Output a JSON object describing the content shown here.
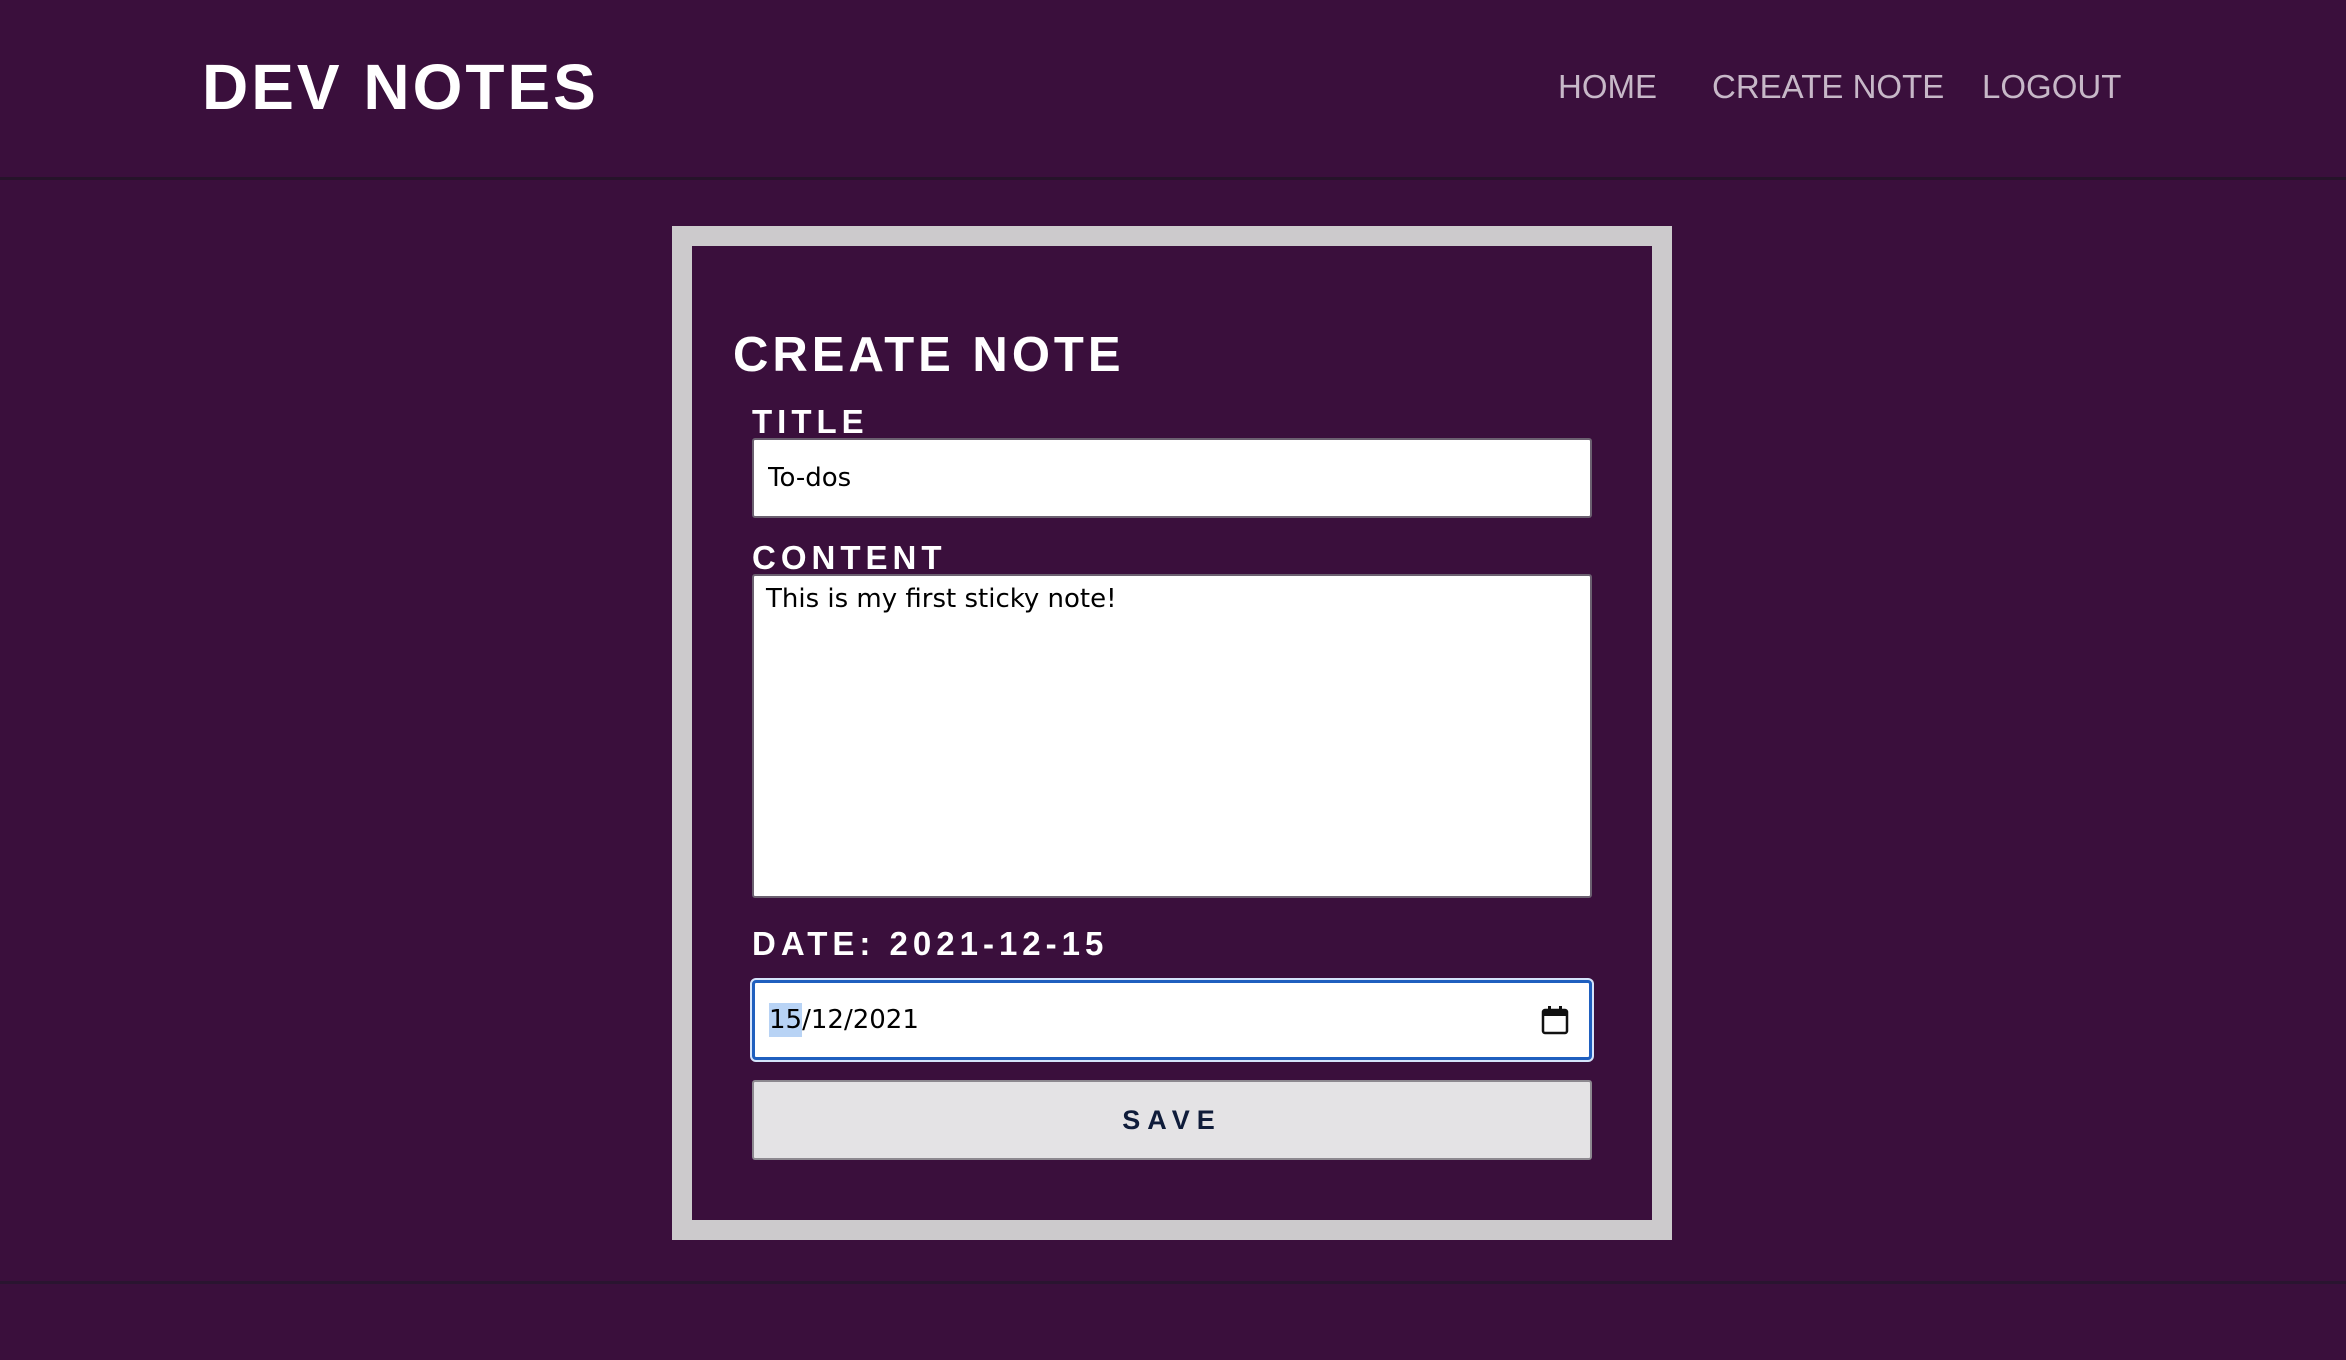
{
  "nav": {
    "brand": "DEV NOTES",
    "links": [
      "HOME",
      "CREATE NOTE",
      "LOGOUT"
    ]
  },
  "form": {
    "heading": "CREATE NOTE",
    "title_label": "TITLE",
    "title_value": "To-dos",
    "content_label": "CONTENT",
    "content_value": "This is my first sticky note!",
    "date_label": "DATE: 2021-12-15",
    "date_day": "15",
    "date_rest": "/12/2021",
    "save_label": "SAVE"
  },
  "colors": {
    "background": "#3a0f3c",
    "card_border": "#cccacc",
    "focus_ring": "#1f5fbf",
    "button_bg": "#e4e3e5",
    "button_text": "#0f1c3a"
  },
  "icons": {
    "date_picker": "calendar-icon"
  }
}
